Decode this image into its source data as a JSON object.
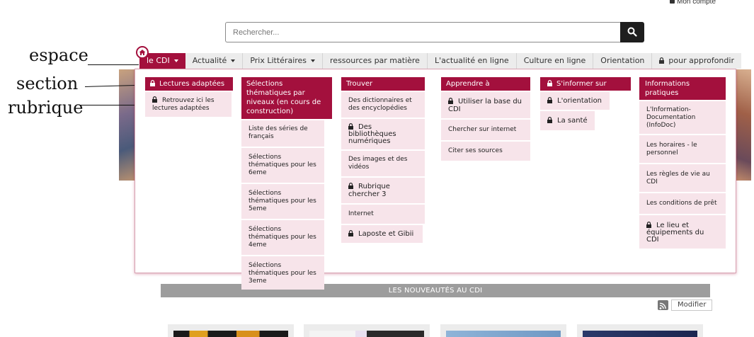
{
  "header": {
    "account_label": "Mon compte",
    "search_placeholder": "Rechercher..."
  },
  "nav": {
    "items": [
      {
        "label": "le CDI",
        "active": true,
        "dropdown": true
      },
      {
        "label": "Actualité",
        "dropdown": true
      },
      {
        "label": "Prix Littéraires",
        "dropdown": true
      },
      {
        "label": "ressources par matière"
      },
      {
        "label": "L'actualité en ligne"
      },
      {
        "label": "Culture en ligne"
      },
      {
        "label": "Orientation"
      },
      {
        "label": "pour approfondir",
        "locked": true
      }
    ]
  },
  "menu": {
    "columns": [
      {
        "title": "Lectures adaptées",
        "locked": true,
        "items": [
          {
            "label": "Retrouvez ici les lectures adaptées",
            "locked": true
          }
        ]
      },
      {
        "title": "Sélections thématiques par niveaux (en cours de construction)",
        "items": [
          {
            "label": "Liste des séries de français"
          },
          {
            "label": "Sélections thématiques pour les 6eme"
          },
          {
            "label": "Sélections thématiques pour les 5eme"
          },
          {
            "label": "Sélections thématiques pour les 4eme"
          },
          {
            "label": "Sélections thématiques pour les 3eme"
          }
        ]
      },
      {
        "title": "Trouver",
        "items": [
          {
            "label": "Des dictionnaires et des encyclopédies"
          },
          {
            "label": "Des bibliothèques numériques",
            "locked": true
          },
          {
            "label": "Des images et des vidéos"
          },
          {
            "label": "Rubrique chercher 3",
            "locked": true
          },
          {
            "label": "Internet"
          },
          {
            "label": "Laposte et Gibii",
            "locked": true
          }
        ]
      },
      {
        "title": "Apprendre à",
        "items": [
          {
            "label": "Utiliser la base du CDI",
            "locked": true
          },
          {
            "label": "Chercher sur internet"
          },
          {
            "label": "Citer ses sources"
          }
        ]
      },
      {
        "title": "S'informer sur",
        "locked": true,
        "items": [
          {
            "label": "L'orientation",
            "locked": true
          },
          {
            "label": "La santé",
            "locked": true
          }
        ]
      },
      {
        "title": "Informations pratiques",
        "items": [
          {
            "label": "L'Information-Documentation (InfoDoc)"
          },
          {
            "label": "Les horaires - le personnel"
          },
          {
            "label": "Les règles de vie au CDI"
          },
          {
            "label": "Les conditions de prêt"
          },
          {
            "label": "Le lieu et équipements du CDI",
            "locked": true
          }
        ]
      }
    ]
  },
  "annotations": {
    "espace": "espace",
    "section": "section",
    "rubrique": "rubrique"
  },
  "news": {
    "title": "LES NOUVEAUTÉS AU CDI",
    "edit_label": "Modifier"
  },
  "colors": {
    "accent": "#a3103d",
    "item_bg": "#f7e4ea",
    "navbar_bg": "#ececec",
    "news_bar": "#9d9d9d"
  }
}
